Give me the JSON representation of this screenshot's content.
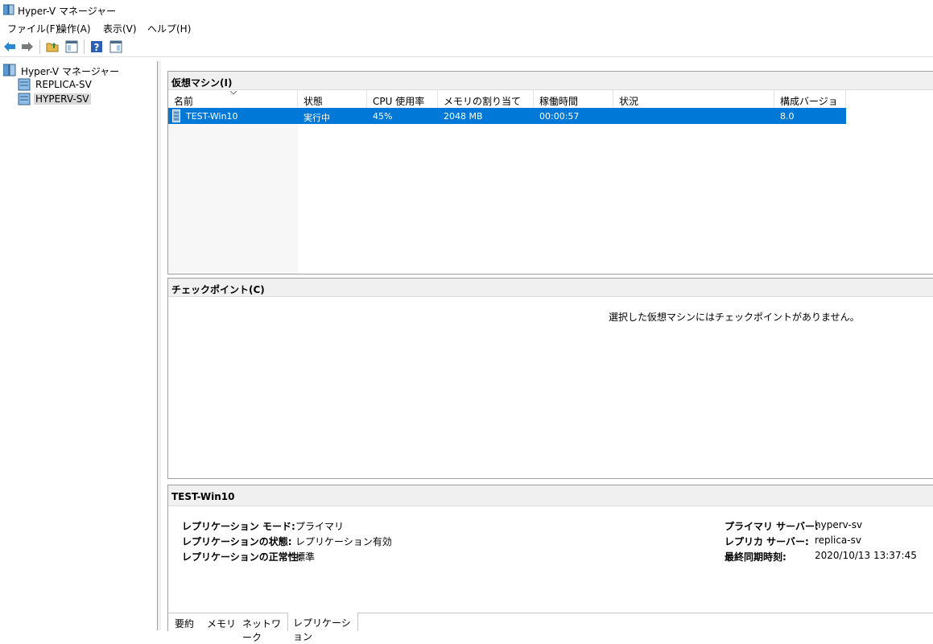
{
  "window": {
    "title": "Hyper-V マネージャー",
    "icon": "hyperv-manager-icon"
  },
  "menu": [
    "ファイル(F)",
    "操作(A)",
    "表示(V)",
    "ヘルプ(H)"
  ],
  "toolbar": {
    "icons": [
      "back-arrow-icon",
      "forward-arrow-icon",
      "folder-up-icon",
      "show-hide-tree-icon",
      "help-icon",
      "action-pane-icon"
    ]
  },
  "tree": {
    "root": "Hyper-V マネージャー",
    "servers": [
      "REPLICA-SV",
      "HYPERV-SV"
    ],
    "selected": "HYPERV-SV"
  },
  "vm_panel": {
    "title": "仮想マシン(I)",
    "columns": [
      "名前",
      "状態",
      "CPU 使用率",
      "メモリの割り当て",
      "稼働時間",
      "状況",
      "構成バージョン"
    ],
    "rows": [
      {
        "name": "TEST-Win10",
        "state": "実行中",
        "cpu": "45%",
        "memory": "2048 MB",
        "uptime": "00:00:57",
        "status": "",
        "version": "8.0"
      }
    ]
  },
  "checkpoint_panel": {
    "title": "チェックポイント(C)",
    "empty_message": "選択した仮想マシンにはチェックポイントがありません。"
  },
  "detail_panel": {
    "title": "TEST-Win10",
    "left": [
      {
        "label": "レプリケーション モード:",
        "value": "プライマリ"
      },
      {
        "label": "レプリケーションの状態:",
        "value": "レプリケーション有効"
      },
      {
        "label": "レプリケーションの正常性:",
        "value": "標準"
      }
    ],
    "right": [
      {
        "label": "プライマリ サーバー:",
        "value": "hyperv-sv"
      },
      {
        "label": "レプリカ サーバー:",
        "value": "replica-sv"
      },
      {
        "label": "最終同期時刻:",
        "value": "2020/10/13 13:37:45"
      }
    ],
    "tabs": [
      "要約",
      "メモリ",
      "ネットワーク",
      "レプリケーション"
    ],
    "active_tab": "レプリケーション"
  }
}
